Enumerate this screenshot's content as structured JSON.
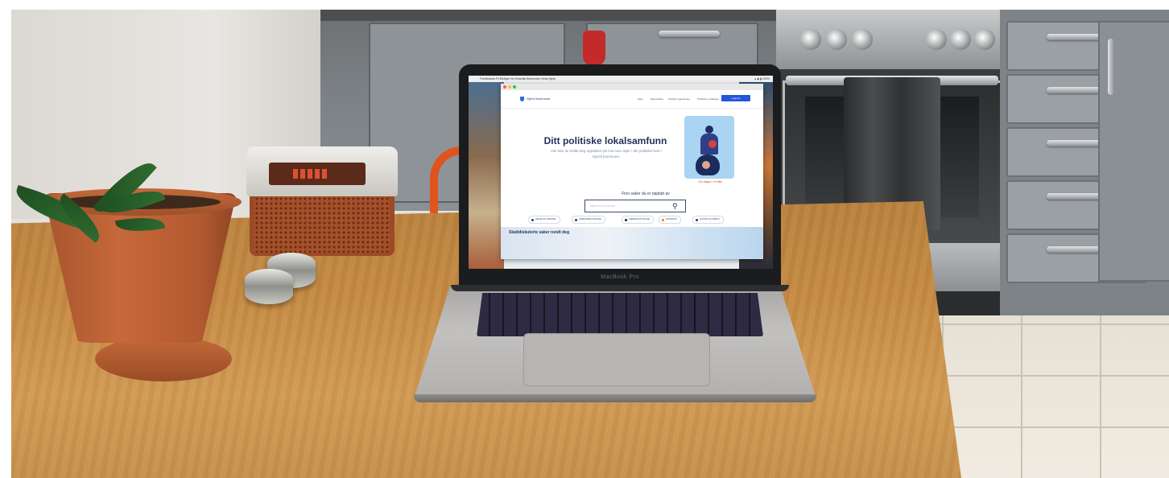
{
  "scene": "laptop-on-kitchen-table",
  "laptop": {
    "model_label": "MacBook Pro",
    "screen": {
      "menubar": {
        "apple": "",
        "menus": "Forhåndsvis  Fil  Rediger  Vis  Historikk  Bokmerker  Vindu  Hjelp",
        "status": "▴ ◉ ▮ 100%"
      },
      "site": {
        "logo_text": "Gjerdi kommune",
        "nav": [
          "Hjem",
          "Møter/saker",
          "Politisk organisering",
          "Politikere i kataloger"
        ],
        "login_label": "Logg inn",
        "hero_title": "Ditt politiske lokalsamfunn",
        "hero_subtitle": "Her kan du holde deg oppdatert på hva som skjer i det politiske livet i Gjerdi kommune.",
        "illustration_caption": "Om dagen i et blikk",
        "search_label": "Finn saker du er opptatt av",
        "search_placeholder": "Skriv inn et emne ...",
        "tags": [
          {
            "label": "HELSE OG OMSORG",
            "color": "#1d3f8f"
          },
          {
            "label": "SAMFUNNSUTVIKLING",
            "color": "#1d3f8f"
          },
          {
            "label": "NÆRINGSUTVIKLING",
            "color": "#222222"
          },
          {
            "label": "OPPVEKST",
            "color": "#e47a1f"
          },
          {
            "label": "KULTUR OG IDRETT",
            "color": "#1d3f8f"
          }
        ],
        "section_heading": "Stadidiskuterte saker rundt deg"
      }
    }
  },
  "colors": {
    "primary_button": "#2357d9",
    "title_navy": "#1f3158",
    "table_wood": "#c48a44",
    "pot_terracotta": "#b45a30"
  }
}
